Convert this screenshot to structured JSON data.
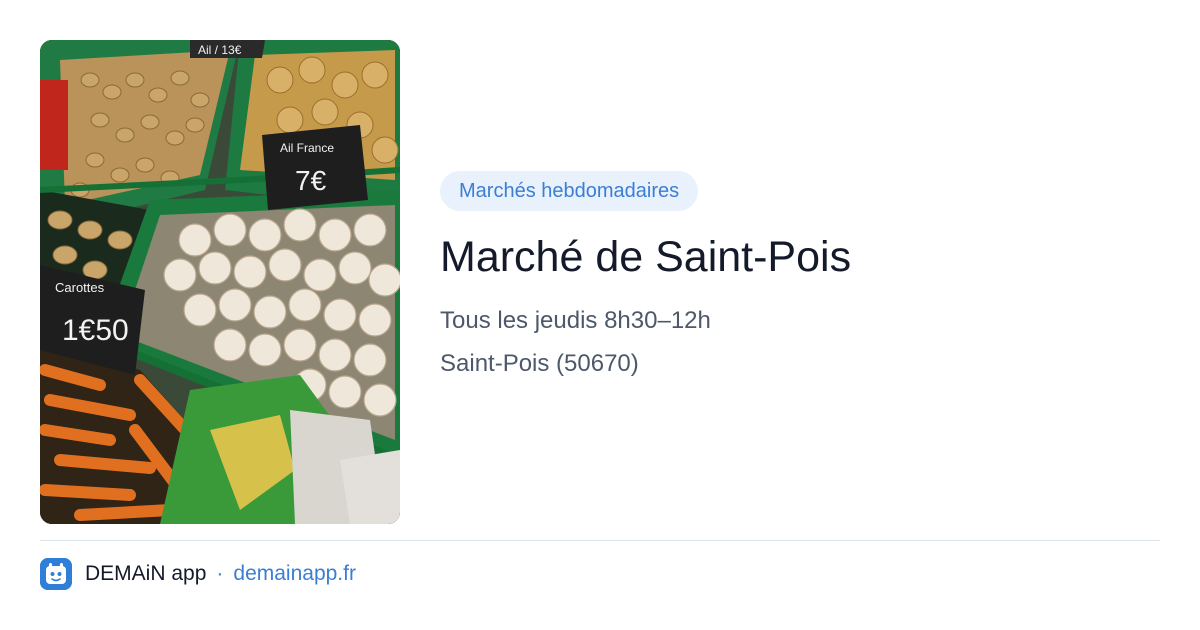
{
  "card": {
    "image_alt": "Étal de légumes au marché",
    "sign_texts": [
      "Ail / 13€",
      "Ail France",
      "7€",
      "Carottes",
      "1€50"
    ],
    "category": "Marchés hebdomadaires",
    "title": "Marché de Saint-Pois",
    "schedule": "Tous les jeudis 8h30–12h",
    "location": "Saint-Pois (50670)"
  },
  "footer": {
    "app_name": "DEMAiN app",
    "separator": "·",
    "url": "demainapp.fr"
  },
  "colors": {
    "accent": "#3c7ed4",
    "badge_bg": "#e8f1fc",
    "title": "#141a2a",
    "secondary_text": "#4d586b",
    "divider": "#dde4ea",
    "logo_bg": "#2f7fd9"
  },
  "icons": {
    "app_logo": "demain-app-logo-icon"
  }
}
